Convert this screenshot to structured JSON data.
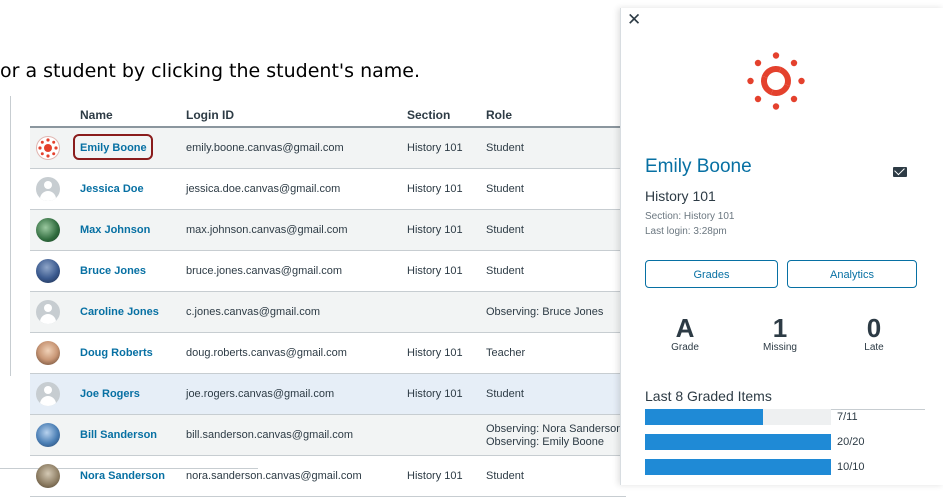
{
  "instruction": "or a student by clicking the student's name.",
  "table": {
    "headers": [
      "Name",
      "Login ID",
      "Section",
      "Role"
    ],
    "rows": [
      {
        "name": "Emily Boone",
        "login": "emily.boone.canvas@gmail.com",
        "section": "History 101",
        "role": "Student",
        "avatar": "canvas-logo-avatar"
      },
      {
        "name": "Jessica Doe",
        "login": "jessica.doe.canvas@gmail.com",
        "section": "History 101",
        "role": "Student",
        "avatar": "default-avatar"
      },
      {
        "name": "Max Johnson",
        "login": "max.johnson.canvas@gmail.com",
        "section": "History 101",
        "role": "Student",
        "avatar": "photo-avatar"
      },
      {
        "name": "Bruce Jones",
        "login": "bruce.jones.canvas@gmail.com",
        "section": "History 101",
        "role": "Student",
        "avatar": "photo-avatar"
      },
      {
        "name": "Caroline Jones",
        "login": "c.jones.canvas@gmail.com",
        "section": "",
        "role": "Observing: Bruce Jones",
        "avatar": "default-avatar"
      },
      {
        "name": "Doug Roberts",
        "login": "doug.roberts.canvas@gmail.com",
        "section": "History 101",
        "role": "Teacher",
        "avatar": "photo-avatar"
      },
      {
        "name": "Joe Rogers",
        "login": "joe.rogers.canvas@gmail.com",
        "section": "History 101",
        "role": "Student",
        "avatar": "default-avatar"
      },
      {
        "name": "Bill Sanderson",
        "login": "bill.sanderson.canvas@gmail.com",
        "section": "",
        "role": "Observing: Nora Sanderson",
        "role2": "Observing: Emily Boone",
        "avatar": "photo-avatar"
      },
      {
        "name": "Nora Sanderson",
        "login": "nora.sanderson.canvas@gmail.com",
        "section": "History 101",
        "role": "Student",
        "avatar": "photo-avatar"
      }
    ]
  },
  "tray": {
    "close": "✕",
    "student_name": "Emily Boone",
    "course": "History 101",
    "section": "Section: History 101",
    "last_login": "Last login: 3:28pm",
    "grades_button": "Grades",
    "analytics_button": "Analytics",
    "stats": [
      {
        "value": "A",
        "label": "Grade"
      },
      {
        "value": "1",
        "label": "Missing"
      },
      {
        "value": "0",
        "label": "Late"
      }
    ],
    "graded_title": "Last 8 Graded Items",
    "graded_items": [
      {
        "label": "7/11",
        "fraction": 0.636
      },
      {
        "label": "20/20",
        "fraction": 1.0
      },
      {
        "label": "10/10",
        "fraction": 1.0
      }
    ]
  },
  "colors": {
    "link": "#0770a3",
    "bar": "#1f8ad6",
    "canvas_red": "#e4412d",
    "highlight_border": "#8a1c1c"
  }
}
